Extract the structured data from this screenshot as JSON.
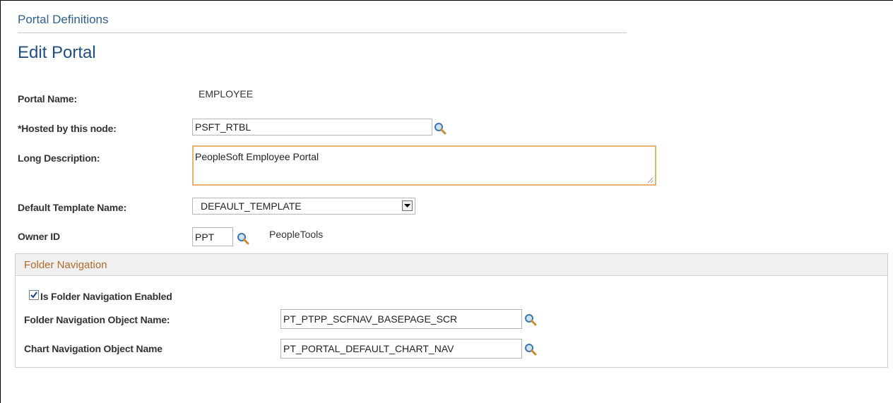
{
  "header": {
    "breadcrumb": "Portal Definitions",
    "title": "Edit Portal"
  },
  "form": {
    "portal_name_label": "Portal Name:",
    "portal_name_value": "EMPLOYEE",
    "hosted_node_label": "*Hosted by this node:",
    "hosted_node_value": "PSFT_RTBL",
    "long_desc_label": "Long Description:",
    "long_desc_value": "PeopleSoft Employee Portal",
    "default_template_label": "Default Template Name:",
    "default_template_value": "DEFAULT_TEMPLATE",
    "owner_id_label": "Owner ID",
    "owner_id_value": "PPT",
    "owner_id_desc": "PeopleTools"
  },
  "folder_nav": {
    "section_title": "Folder Navigation",
    "enabled_label": "Is Folder Navigation Enabled",
    "enabled_checked": true,
    "folder_obj_label": "Folder Navigation Object Name:",
    "folder_obj_value": "PT_PTPP_SCFNAV_BASEPAGE_SCR",
    "chart_obj_label": "Chart Navigation Object Name",
    "chart_obj_value": "PT_PORTAL_DEFAULT_CHART_NAV"
  },
  "icons": {
    "lookup": "magnifier-lookup-icon",
    "dropdown": "chevron-down-icon",
    "check": "checkmark-icon"
  },
  "colors": {
    "breadcrumb": "#2f5f8f",
    "title": "#1f4f7f",
    "section_title": "#b06a2a",
    "focus_border": "#e8b36a"
  }
}
